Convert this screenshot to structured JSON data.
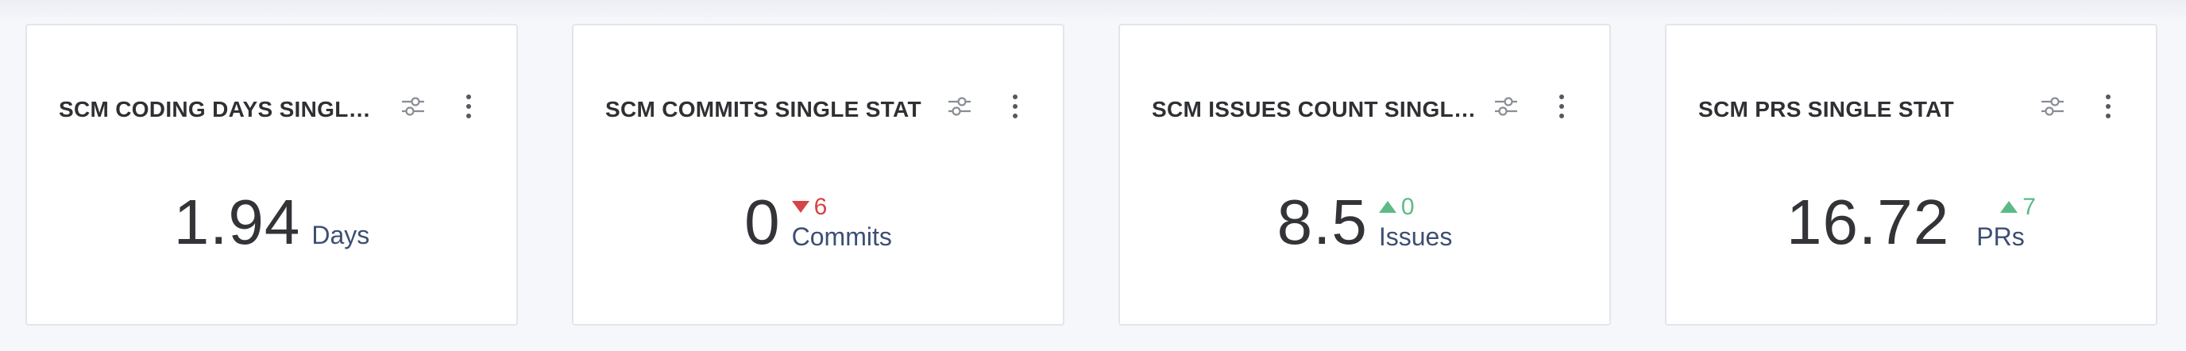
{
  "colors": {
    "trend_down": "#d64545",
    "trend_up": "#5dba86",
    "unit_text": "#3c4f73",
    "value_text": "#333438"
  },
  "cards": [
    {
      "title": "SCM CODING DAYS SINGLE ...",
      "value": "1.94",
      "unit": "Days",
      "trend": null,
      "icons": [
        "sliders-icon",
        "more-vertical-icon"
      ]
    },
    {
      "title": "SCM COMMITS SINGLE STAT",
      "value": "0",
      "unit": "Commits",
      "trend": {
        "direction": "down",
        "value": "6"
      },
      "icons": [
        "sliders-icon",
        "more-vertical-icon"
      ]
    },
    {
      "title": "SCM ISSUES COUNT SINGLE...",
      "value": "8.5",
      "unit": "Issues",
      "trend": {
        "direction": "up",
        "value": "0"
      },
      "icons": [
        "sliders-icon",
        "more-vertical-icon"
      ]
    },
    {
      "title": "SCM PRS SINGLE STAT",
      "value": "16.72",
      "unit": "PRs",
      "trend": {
        "direction": "up",
        "value": "7"
      },
      "icons": [
        "sliders-icon",
        "more-vertical-icon"
      ]
    }
  ]
}
